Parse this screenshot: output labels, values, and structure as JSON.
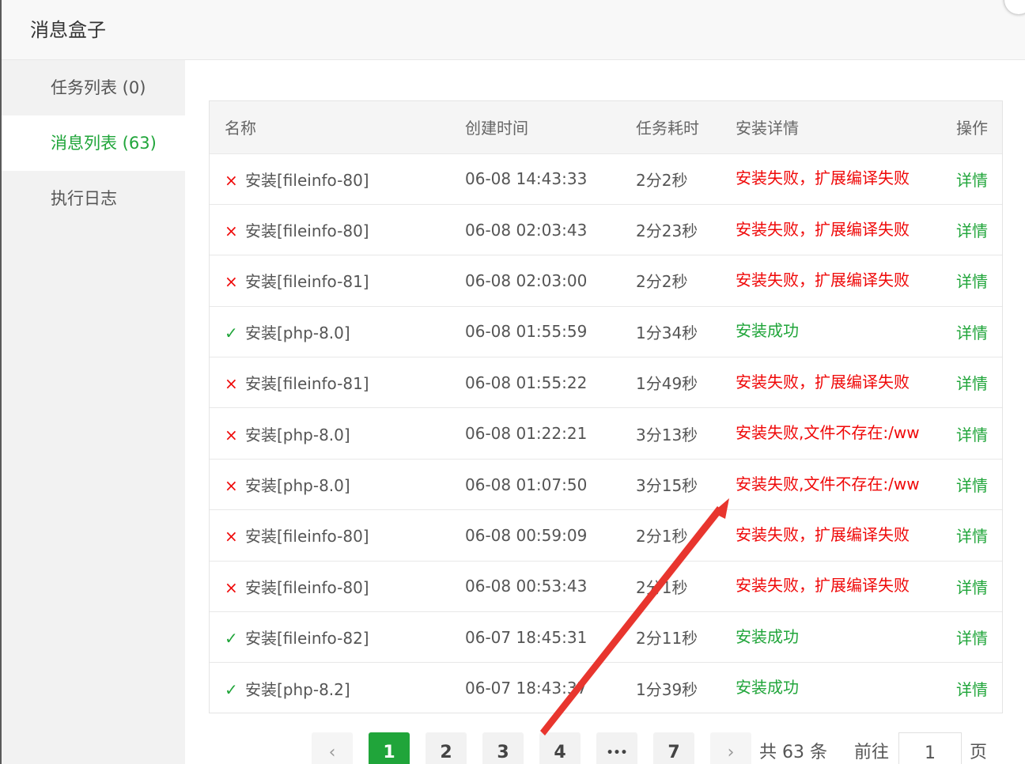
{
  "dialog": {
    "title": "消息盒子"
  },
  "sidebar": {
    "items": [
      {
        "label": "任务列表 (0)"
      },
      {
        "label": "消息列表 (63)"
      },
      {
        "label": "执行日志"
      }
    ]
  },
  "table": {
    "headers": [
      "名称",
      "创建时间",
      "任务耗时",
      "安装详情",
      "操作"
    ],
    "rows": [
      {
        "status": "fail",
        "name": "安装[fileinfo-80]",
        "time": "06-08 14:43:33",
        "duration": "2分2秒",
        "detail": "安装失败，扩展编译失败",
        "op": "详情"
      },
      {
        "status": "fail",
        "name": "安装[fileinfo-80]",
        "time": "06-08 02:03:43",
        "duration": "2分23秒",
        "detail": "安装失败，扩展编译失败",
        "op": "详情"
      },
      {
        "status": "fail",
        "name": "安装[fileinfo-81]",
        "time": "06-08 02:03:00",
        "duration": "2分2秒",
        "detail": "安装失败，扩展编译失败",
        "op": "详情"
      },
      {
        "status": "ok",
        "name": "安装[php-8.0]",
        "time": "06-08 01:55:59",
        "duration": "1分34秒",
        "detail": "安装成功",
        "op": "详情"
      },
      {
        "status": "fail",
        "name": "安装[fileinfo-81]",
        "time": "06-08 01:55:22",
        "duration": "1分49秒",
        "detail": "安装失败，扩展编译失败",
        "op": "详情"
      },
      {
        "status": "fail",
        "name": "安装[php-8.0]",
        "time": "06-08 01:22:21",
        "duration": "3分13秒",
        "detail": "安装失败,文件不存在:/ww",
        "op": "详情"
      },
      {
        "status": "fail",
        "name": "安装[php-8.0]",
        "time": "06-08 01:07:50",
        "duration": "3分15秒",
        "detail": "安装失败,文件不存在:/ww",
        "op": "详情"
      },
      {
        "status": "fail",
        "name": "安装[fileinfo-80]",
        "time": "06-08 00:59:09",
        "duration": "2分1秒",
        "detail": "安装失败，扩展编译失败",
        "op": "详情"
      },
      {
        "status": "fail",
        "name": "安装[fileinfo-80]",
        "time": "06-08 00:53:43",
        "duration": "2分1秒",
        "detail": "安装失败，扩展编译失败",
        "op": "详情"
      },
      {
        "status": "ok",
        "name": "安装[fileinfo-82]",
        "time": "06-07 18:45:31",
        "duration": "2分11秒",
        "detail": "安装成功",
        "op": "详情"
      },
      {
        "status": "ok",
        "name": "安装[php-8.2]",
        "time": "06-07 18:43:37",
        "duration": "1分39秒",
        "detail": "安装成功",
        "op": "详情"
      }
    ]
  },
  "pagination": {
    "prev": "‹",
    "pages": [
      "1",
      "2",
      "3",
      "4",
      "•••",
      "7"
    ],
    "current": "1",
    "next": "›",
    "total": "共 63 条",
    "goto_prefix": "前往",
    "goto_value": "1",
    "goto_suffix": "页"
  },
  "icons": {
    "fail": "×",
    "ok": "✓"
  },
  "colors": {
    "accent": "#20a53a",
    "error": "#ef0808",
    "annotation_arrow": "#e8352e"
  }
}
